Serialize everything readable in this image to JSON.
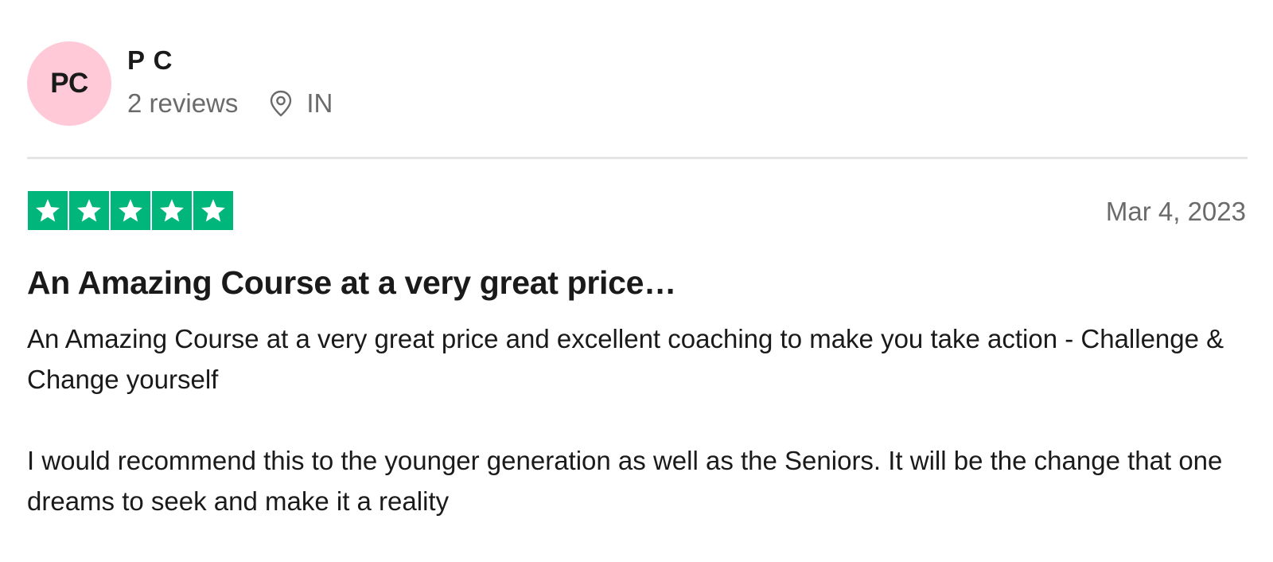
{
  "reviewer": {
    "initials": "PC",
    "avatar_color": "#ffc9d8",
    "name": "P C",
    "reviews_count": "2 reviews",
    "location_icon": "location-pin-icon",
    "country": "IN"
  },
  "review": {
    "rating": 5,
    "rating_max": 5,
    "star_color": "#00b67a",
    "date": "Mar 4, 2023",
    "title": "An Amazing Course at a very great price…",
    "paragraphs": [
      "An Amazing Course at a very great price and excellent coaching to make you take action - Challenge & Change yourself",
      "I would recommend this to the younger generation as well as the Seniors. It will be the change that one dreams to seek and make it a reality"
    ]
  }
}
